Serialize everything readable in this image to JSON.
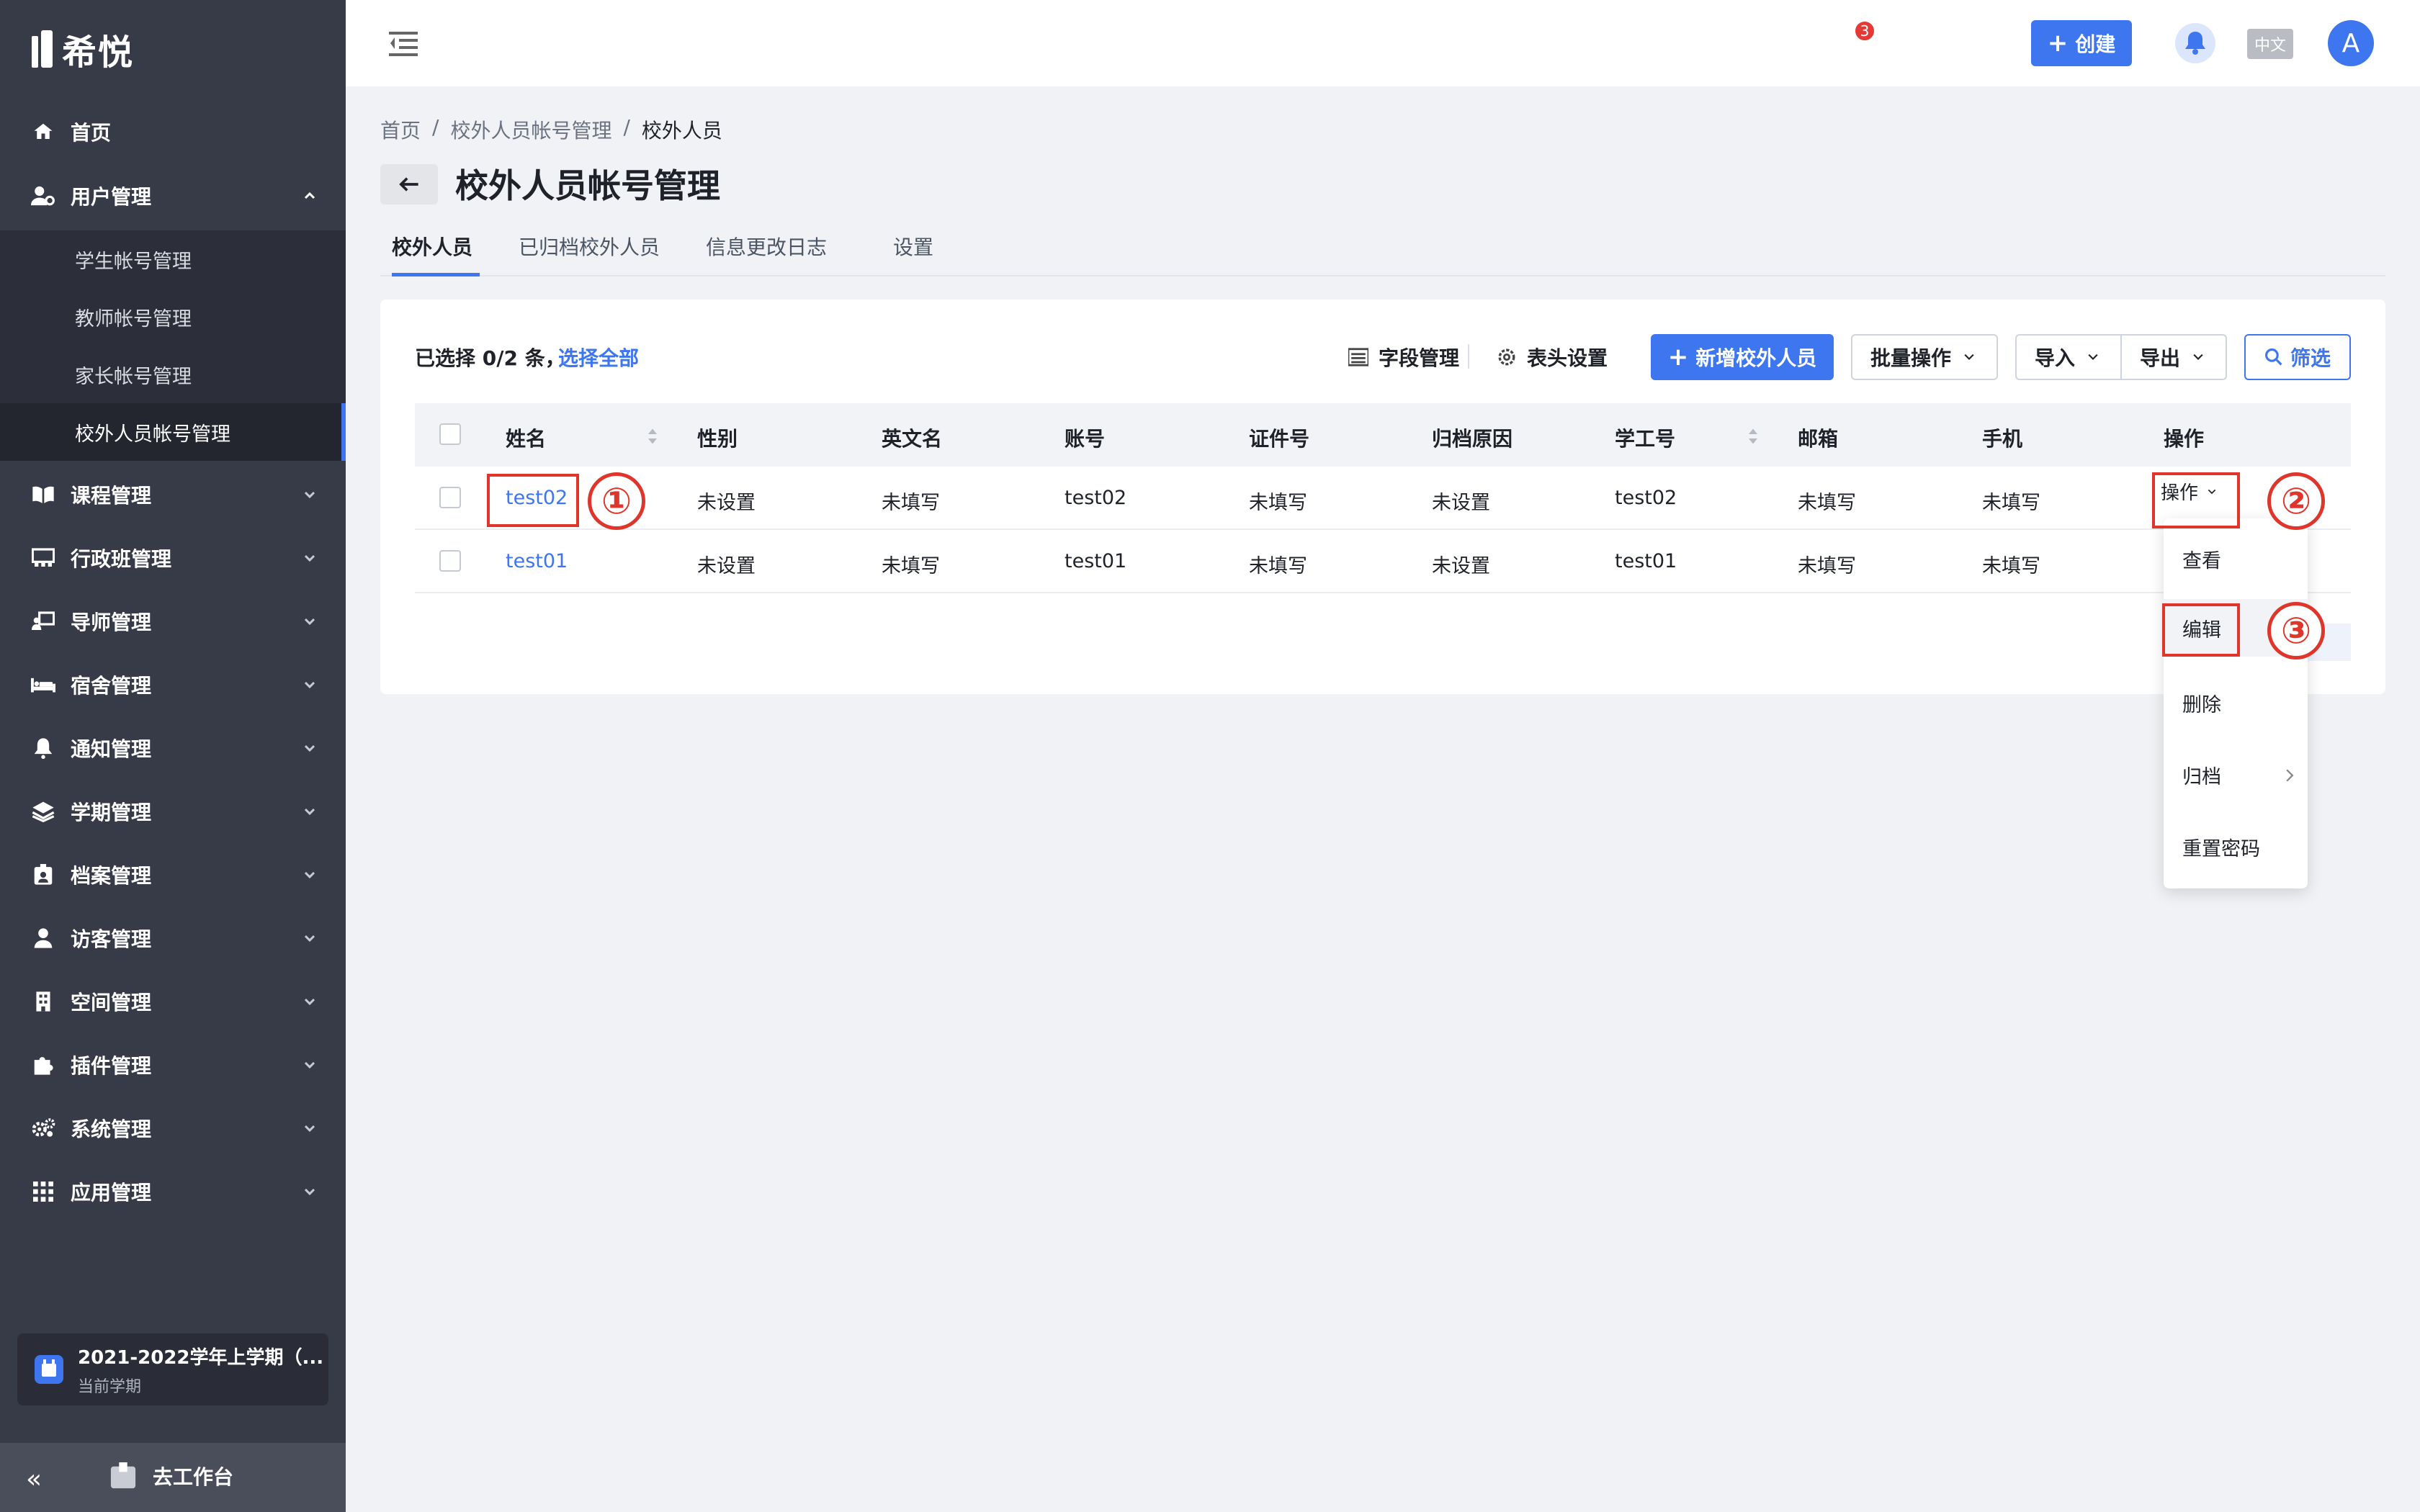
{
  "app": {
    "logo_text": "希悦"
  },
  "sidebar": {
    "items": [
      {
        "label": "首页",
        "icon": "home-icon"
      },
      {
        "label": "用户管理",
        "icon": "user-settings-icon",
        "expanded": true
      },
      {
        "label": "课程管理",
        "icon": "book-icon"
      },
      {
        "label": "行政班管理",
        "icon": "class-icon"
      },
      {
        "label": "导师管理",
        "icon": "mentor-icon"
      },
      {
        "label": "宿舍管理",
        "icon": "bed-icon"
      },
      {
        "label": "通知管理",
        "icon": "bell-icon"
      },
      {
        "label": "学期管理",
        "icon": "layers-icon"
      },
      {
        "label": "档案管理",
        "icon": "archive-icon"
      },
      {
        "label": "访客管理",
        "icon": "visitor-icon"
      },
      {
        "label": "空间管理",
        "icon": "building-icon"
      },
      {
        "label": "插件管理",
        "icon": "puzzle-icon"
      },
      {
        "label": "系统管理",
        "icon": "gears-icon"
      },
      {
        "label": "应用管理",
        "icon": "grid-icon"
      }
    ],
    "sub_items": [
      {
        "label": "学生帐号管理"
      },
      {
        "label": "教师帐号管理"
      },
      {
        "label": "家长帐号管理"
      },
      {
        "label": "校外人员帐号管理",
        "active": true
      }
    ],
    "semester": {
      "title": "2021-2022学年上学期（...",
      "subtitle": "当前学期"
    },
    "footer": {
      "collapse": "«",
      "workspace_label": "去工作台"
    }
  },
  "header": {
    "create_label": "创建",
    "notification_count": "3",
    "lang_label": "中文",
    "avatar_letter": "A"
  },
  "breadcrumb": [
    "首页",
    "校外人员帐号管理",
    "校外人员"
  ],
  "page": {
    "title": "校外人员帐号管理"
  },
  "tabs": [
    {
      "label": "校外人员",
      "active": true
    },
    {
      "label": "已归档校外人员"
    },
    {
      "label": "信息更改日志"
    },
    {
      "label": "设置"
    }
  ],
  "toolbar": {
    "selected_text": "已选择 0/2 条，",
    "select_all": "选择全部",
    "field_manage": "字段管理",
    "header_settings": "表头设置",
    "add_button": "新增校外人员",
    "batch_ops": "批量操作",
    "import": "导入",
    "export": "导出",
    "filter": "筛选"
  },
  "table": {
    "columns": [
      "姓名",
      "性别",
      "英文名",
      "账号",
      "证件号",
      "归档原因",
      "学工号",
      "邮箱",
      "手机",
      "操作"
    ],
    "rows": [
      {
        "name": "test02",
        "gender": "未设置",
        "english_name": "未填写",
        "account": "test02",
        "id_number": "未填写",
        "archive_reason": "未设置",
        "staff_id": "test02",
        "email": "未填写",
        "phone": "未填写",
        "action": "操作"
      },
      {
        "name": "test01",
        "gender": "未设置",
        "english_name": "未填写",
        "account": "test01",
        "id_number": "未填写",
        "archive_reason": "未设置",
        "staff_id": "test01",
        "email": "未填写",
        "phone": "未填写"
      }
    ]
  },
  "action_menu": {
    "items": [
      "查看",
      "编辑",
      "删除",
      "归档",
      "重置密码"
    ]
  },
  "annotations": [
    "①",
    "②",
    "③"
  ],
  "colors": {
    "accent": "#3e76ef",
    "sidebar_bg": "#373b48",
    "highlight": "#e0352b"
  }
}
